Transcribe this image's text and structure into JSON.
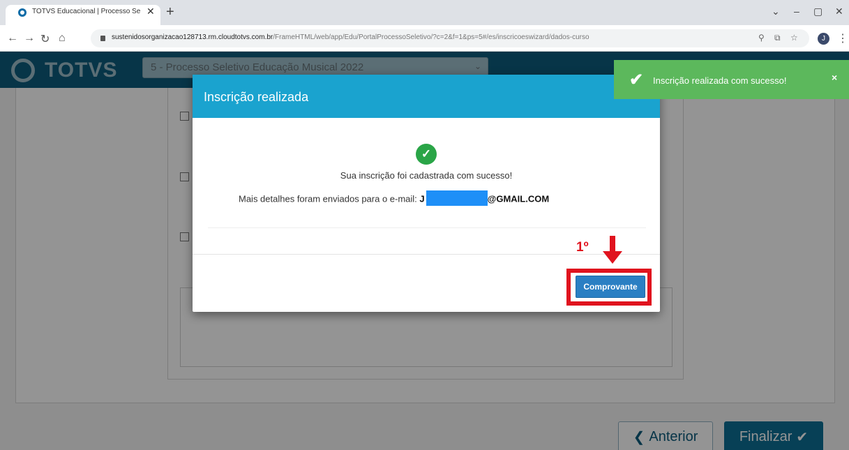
{
  "browser": {
    "tab_title": "TOTVS Educacional | Processo Se",
    "tab_close": "✕",
    "new_tab": "+",
    "url_host": "sustenidosorganizacao128713.rm.cloudtotvs.com.br",
    "url_path": "/FrameHTML/web/app/Edu/PortalProcessoSeletivo/?c=2&f=1&ps=5#/es/inscricoeswizard/dados-curso",
    "profile_initial": "J",
    "icons": [
      "back-icon",
      "forward-icon",
      "reload-icon",
      "home-icon",
      "lock-icon",
      "zoom-icon",
      "share-icon",
      "star-icon",
      "menu-icon"
    ]
  },
  "app": {
    "logo": "TOTVS",
    "process_select": "5 - Processo Seletivo Educação Musical 2022",
    "buttons": {
      "previous": "Anterior",
      "finish": "Finalizar"
    }
  },
  "modal": {
    "title": "Inscrição realizada",
    "success_message": "Sua inscrição foi cadastrada com sucesso!",
    "email_prefix": "Mais detalhes foram enviados para o e-mail:",
    "email_start": "J",
    "email_domain": "@GMAIL.COM",
    "receipt_button": "Comprovante"
  },
  "annotation": {
    "step_label": "1º",
    "color": "#e0131e"
  },
  "toast": {
    "message": "Inscrição realizada com sucesso!",
    "close": "×"
  },
  "colors": {
    "header": "#0d5c7c",
    "modal_header": "#1aa3cf",
    "success": "#2aa547",
    "toast": "#5cb85c",
    "button": "#2a7fc3"
  }
}
